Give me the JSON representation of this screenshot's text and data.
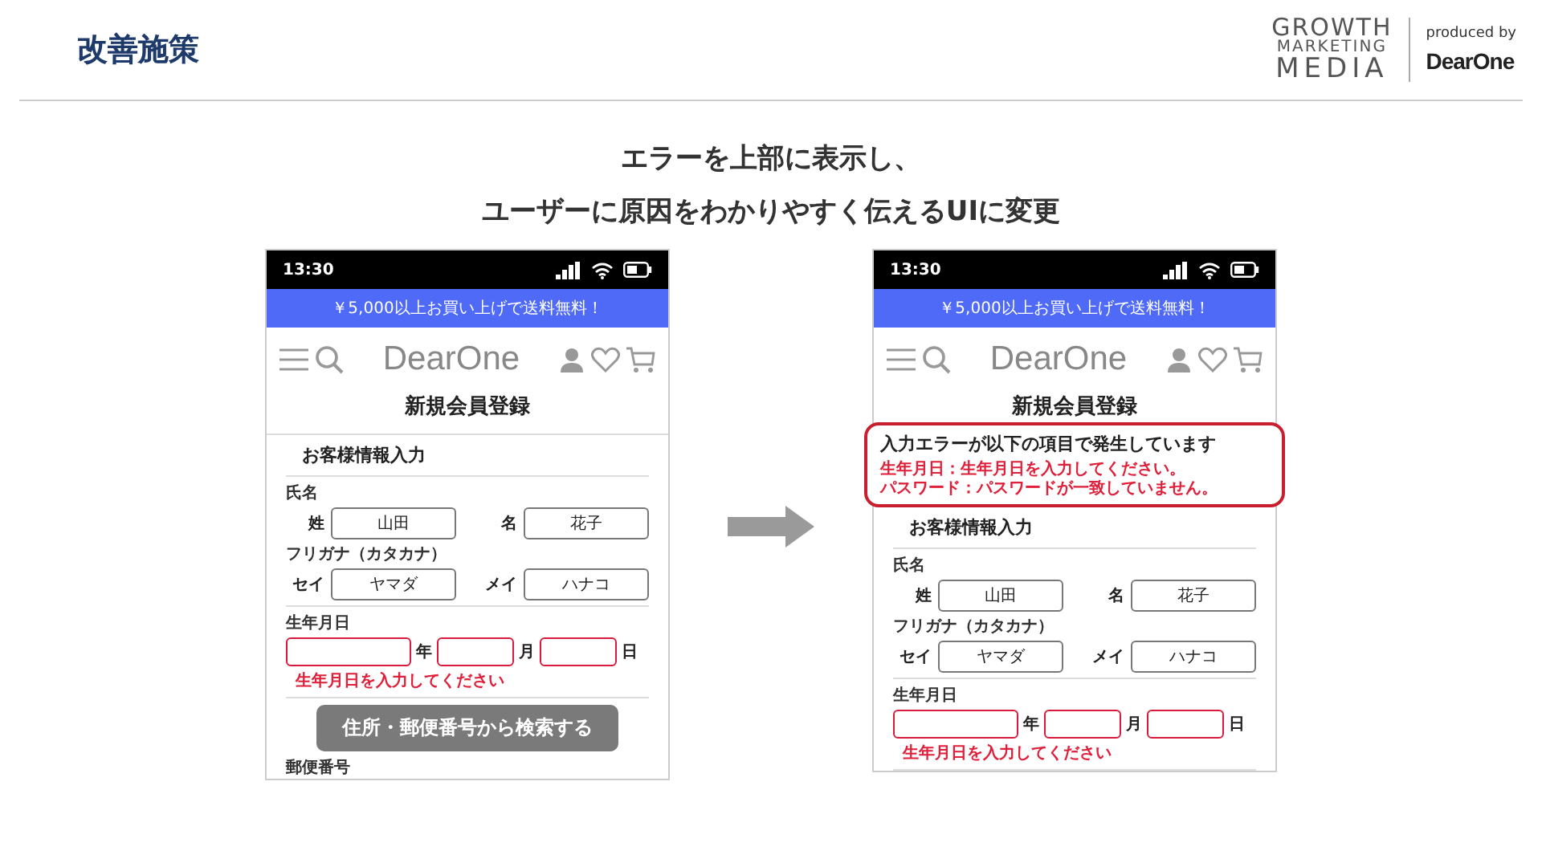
{
  "header": {
    "title": "改善施策",
    "logo": {
      "lines": [
        "GROWTH",
        "MARKETING",
        "MEDIA"
      ],
      "produced_by": "produced by",
      "brand": "DearOne"
    }
  },
  "headline": [
    "エラーを上部に表示し、",
    "ユーザーに原因をわかりやすく伝えるUIに変更"
  ],
  "phones": [
    {
      "time": "13:30",
      "banner": "￥5,000以上お買い上げで送料無料！",
      "brand": "DearOne",
      "page_title": "新規会員登録",
      "section_title": "お客様情報入力",
      "name_groups": [
        {
          "label": "氏名",
          "pairs": [
            {
              "label": "姓",
              "value": "山田"
            },
            {
              "label": "名",
              "value": "花子"
            }
          ]
        },
        {
          "label": "フリガナ（カタカナ）",
          "pairs": [
            {
              "label": "セイ",
              "value": "ヤマダ"
            },
            {
              "label": "メイ",
              "value": "ハナコ"
            }
          ]
        }
      ],
      "birth": {
        "label": "生年月日",
        "fields": [
          {
            "unit": "年",
            "error": true
          },
          {
            "unit": "月",
            "error": true
          },
          {
            "unit": "日",
            "error": true
          }
        ],
        "error": "生年月日を入力してください"
      },
      "search_button": "住所・郵便番号から検索する",
      "bottom_label": "郵便番号"
    },
    {
      "time": "13:30",
      "banner": "￥5,000以上お買い上げで送料無料！",
      "brand": "DearOne",
      "page_title": "新規会員登録",
      "error_panel": {
        "title": "入力エラーが以下の項目で発生しています",
        "messages": [
          "生年月日：生年月日を入力してください。",
          "パスワード：パスワードが一致していません。"
        ]
      },
      "section_title": "お客様情報入力",
      "name_groups": [
        {
          "label": "氏名",
          "pairs": [
            {
              "label": "姓",
              "value": "山田"
            },
            {
              "label": "名",
              "value": "花子"
            }
          ]
        },
        {
          "label": "フリガナ（カタカナ）",
          "pairs": [
            {
              "label": "セイ",
              "value": "ヤマダ"
            },
            {
              "label": "メイ",
              "value": "ハナコ"
            }
          ]
        }
      ],
      "birth": {
        "label": "生年月日",
        "fields": [
          {
            "unit": "年",
            "error": true
          },
          {
            "unit": "月",
            "error": true
          },
          {
            "unit": "日",
            "error": true
          }
        ],
        "error": "生年月日を入力してください"
      }
    }
  ]
}
